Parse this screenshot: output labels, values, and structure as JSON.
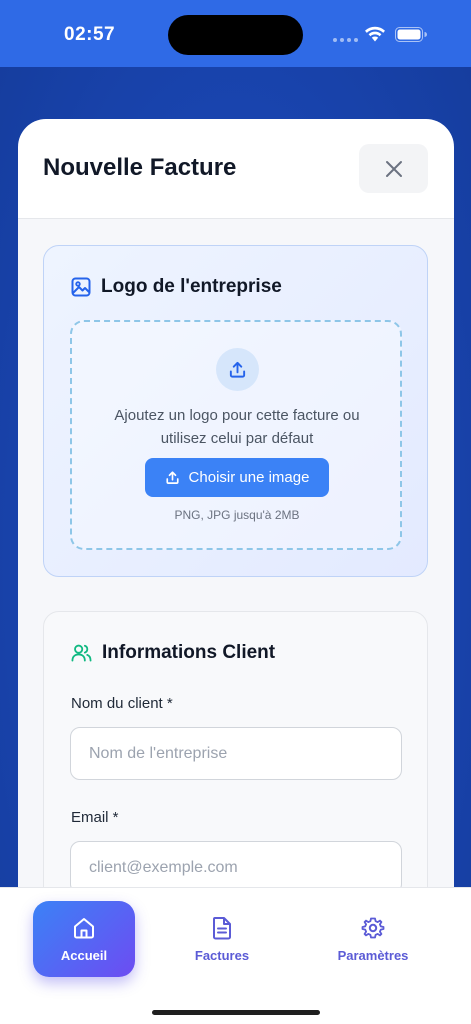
{
  "status_bar": {
    "time": "02:57",
    "icons": [
      "signal-dots-icon",
      "wifi-icon",
      "battery-icon"
    ]
  },
  "modal": {
    "title": "Nouvelle Facture",
    "close_icon": "close-icon"
  },
  "logo_section": {
    "heading": "Logo de l'entreprise",
    "heading_icon": "image-icon",
    "dropzone_text": "Ajoutez un logo pour cette facture ou utilisez celui par défaut",
    "upload_icon": "upload-icon",
    "button_label": "Choisir une image",
    "hint": "PNG, JPG jusqu'à 2MB"
  },
  "client_section": {
    "heading": "Informations Client",
    "heading_icon": "users-icon",
    "fields": [
      {
        "label": "Nom du client *",
        "placeholder": "Nom de l'entreprise",
        "value": ""
      },
      {
        "label": "Email *",
        "placeholder": "client@exemple.com",
        "value": ""
      }
    ]
  },
  "bottom_nav": {
    "items": [
      {
        "label": "Accueil",
        "icon": "home-icon",
        "active": true
      },
      {
        "label": "Factures",
        "icon": "document-icon",
        "active": false
      },
      {
        "label": "Paramètres",
        "icon": "gear-icon",
        "active": false
      }
    ]
  },
  "colors": {
    "accent": "#3b82f6",
    "nav_active_start": "#3b82f6",
    "nav_active_end": "#6d4cf2",
    "nav_inactive": "#5b5bd6",
    "status_bar": "#2f6ae6",
    "client_icon": "#10b981"
  }
}
